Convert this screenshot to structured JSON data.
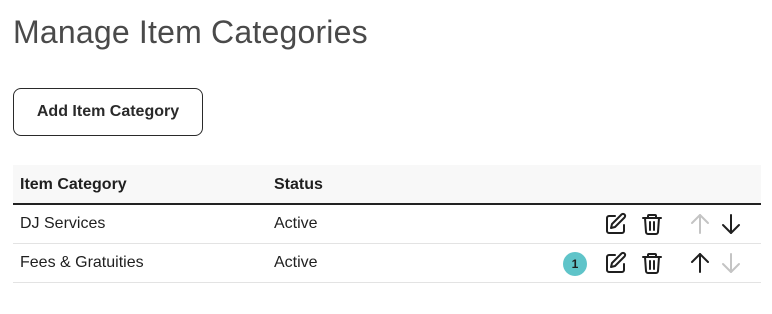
{
  "page": {
    "title": "Manage Item Categories"
  },
  "toolbar": {
    "add_label": "Add Item Category"
  },
  "table": {
    "headers": [
      "Item Category",
      "Status"
    ],
    "rows": [
      {
        "name": "DJ Services",
        "status": "Active",
        "badge": "",
        "up_enabled": false,
        "down_enabled": true
      },
      {
        "name": "Fees & Gratuities",
        "status": "Active",
        "badge": "1",
        "up_enabled": true,
        "down_enabled": false
      }
    ]
  },
  "colors": {
    "badge": "#5fc4c9",
    "icon_active": "#1f1f1f",
    "icon_disabled": "#c4c4c4"
  },
  "icons": [
    "edit-icon",
    "trash-icon",
    "arrow-up-icon",
    "arrow-down-icon"
  ]
}
